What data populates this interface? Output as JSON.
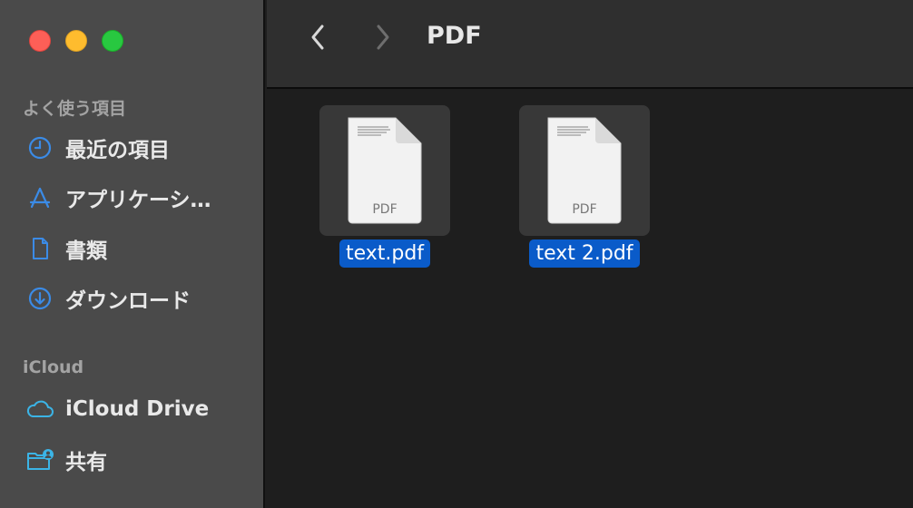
{
  "window": {
    "title": "PDF",
    "traffic_lights": {
      "close": "#fd5f57",
      "minimize": "#febc2e",
      "zoom": "#28c840"
    }
  },
  "toolbar": {
    "back_icon": "chevron-left-icon",
    "forward_icon": "chevron-right-icon"
  },
  "sidebar": {
    "favorites_title": "よく使う項目",
    "favorites": [
      {
        "label": "最近の項目",
        "icon": "clock-icon"
      },
      {
        "label": "アプリケーシ…",
        "icon": "applications-icon"
      },
      {
        "label": "書類",
        "icon": "document-icon"
      },
      {
        "label": "ダウンロード",
        "icon": "download-icon"
      }
    ],
    "icloud_title": "iCloud",
    "icloud": [
      {
        "label": "iCloud Drive",
        "icon": "cloud-icon"
      },
      {
        "label": "共有",
        "icon": "shared-folder-icon"
      }
    ],
    "accent_color": "#3b8be6"
  },
  "files": [
    {
      "name": "text.pdf",
      "type_label": "PDF",
      "selected": true
    },
    {
      "name": "text 2.pdf",
      "type_label": "PDF",
      "selected": true
    }
  ],
  "selection_color": "#0a5bc9"
}
